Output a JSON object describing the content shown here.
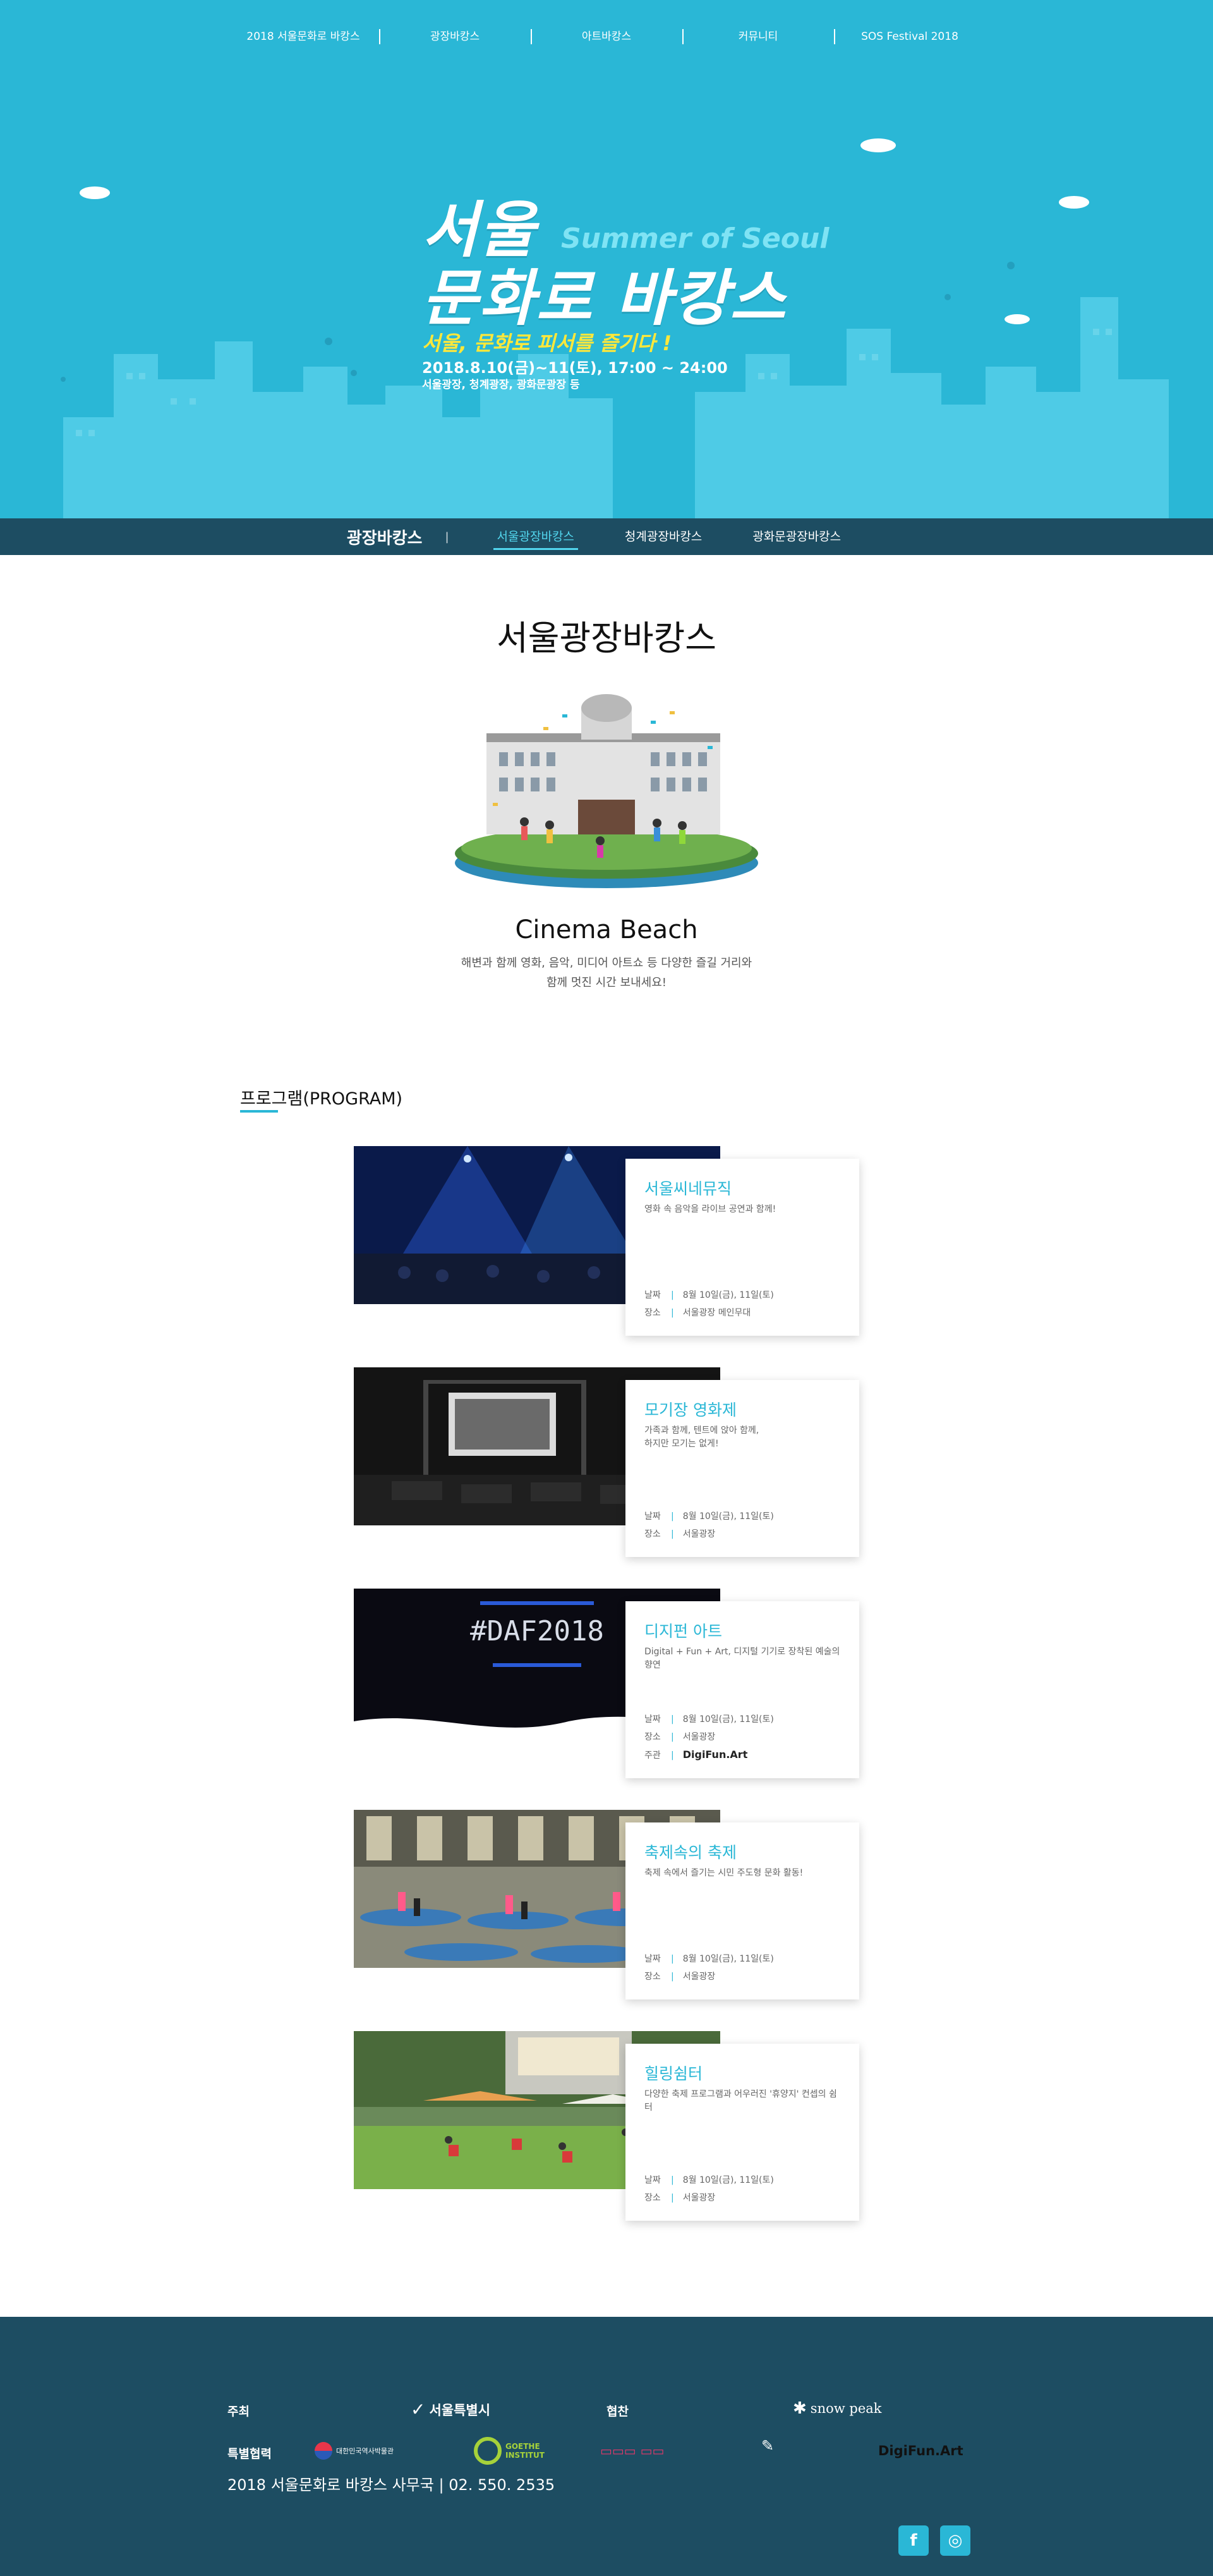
{
  "top_nav": [
    "2018 서울문화로 바캉스",
    "광장바캉스",
    "아트바캉스",
    "커뮤니티",
    "SOS Festival 2018"
  ],
  "hero": {
    "title_line1": "서울",
    "title_line2": "문화로 바캉스",
    "subtitle": "Summer of Seoul",
    "slogan": "서울, 문화로 피서를 즐기다 !",
    "date": "2018.8.10(금)~11(토), 17:00 ~ 24:00",
    "venue": "서울광장, 청계광장, 광화문광장 등"
  },
  "sub_nav": {
    "title": "광장바캉스",
    "separator": "|",
    "tabs": [
      "서울광장바캉스",
      "청계광장바캉스",
      "광화문광장바캉스"
    ],
    "active_tab": "서울광장바캉스"
  },
  "intro": {
    "title": "서울광장바캉스",
    "cinema_title": "Cinema Beach",
    "cinema_desc_1": "해변과 함께 영화, 음악, 미디어 아트쇼 등 다양한 즐길 거리와",
    "cinema_desc_2": "함께 멋진 시간 보내세요!"
  },
  "program": {
    "heading": "프로그램(PROGRAM)",
    "items": [
      {
        "name": "서울씨네뮤직",
        "desc_1": "영화 속 음악을 라이브 공연과 함께!",
        "desc_2": "",
        "rows": [
          {
            "key": "날짜",
            "value": "8월 10일(금), 11일(토)"
          },
          {
            "key": "장소",
            "value": "서울광장 메인무대"
          }
        ]
      },
      {
        "name": "모기장 영화제",
        "desc_1": "가족과 함께, 텐트에 앉아 함께,",
        "desc_2": "하지만 모기는 없게!",
        "rows": [
          {
            "key": "날짜",
            "value": "8월 10일(금), 11일(토)"
          },
          {
            "key": "장소",
            "value": "서울광장"
          }
        ]
      },
      {
        "name": "디지펀 아트",
        "desc_1": "Digital + Fun + Art, 디지털 기기로 장착된 예술의 향연",
        "desc_2": "",
        "rows": [
          {
            "key": "날짜",
            "value": "8월 10일(금), 11일(토)"
          },
          {
            "key": "장소",
            "value": "서울광장"
          },
          {
            "key": "주관",
            "value": "DigiFun.Art"
          }
        ]
      },
      {
        "name": "축제속의 축제",
        "desc_1": "축제 속에서 즐기는 시민 주도형 문화 활동!",
        "desc_2": "",
        "rows": [
          {
            "key": "날짜",
            "value": "8월 10일(금), 11일(토)"
          },
          {
            "key": "장소",
            "value": "서울광장"
          }
        ]
      },
      {
        "name": "힐링쉼터",
        "desc_1": "다양한 축제 프로그램과 어우러진 '휴양지' 컨셉의 쉼터",
        "desc_2": "",
        "rows": [
          {
            "key": "날짜",
            "value": "8월 10일(금), 11일(토)"
          },
          {
            "key": "장소",
            "value": "서울광장"
          }
        ]
      }
    ],
    "photo_daf_text": "#DAF2018"
  },
  "footer": {
    "host_label": "주최",
    "host_logo": "서울특별시",
    "sponsor_label": "협찬",
    "sponsor_logo": "snow peak",
    "partner_label": "특별협력",
    "partners": [
      "대한민국역사박물관",
      "GOETHE INSTITUT",
      "DigiFun.Art"
    ],
    "contact": "2018 서울문화로 바캉스 사무국 | 02. 550. 2535",
    "sns": [
      "f",
      "◎"
    ]
  },
  "colors": {
    "hero_bg": "#2ab7d6",
    "nav_bar": "#1d4d62",
    "accent": "#2ab7d6",
    "slogan": "#ffe83a"
  }
}
